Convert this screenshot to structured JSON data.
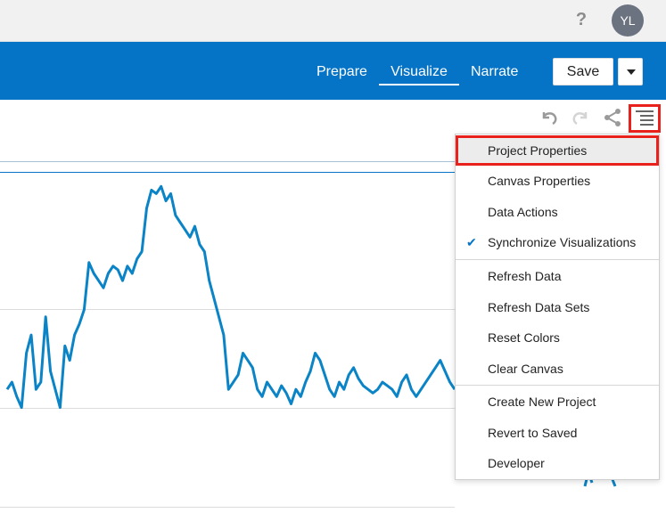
{
  "header": {
    "help_glyph": "?",
    "avatar_initials": "YL"
  },
  "nav": {
    "tabs": [
      {
        "label": "Prepare",
        "active": false
      },
      {
        "label": "Visualize",
        "active": true
      },
      {
        "label": "Narrate",
        "active": false
      }
    ],
    "save_label": "Save"
  },
  "toolbar": {
    "icons": [
      "undo-icon",
      "redo-icon",
      "share-icon",
      "menu-icon"
    ]
  },
  "menu": {
    "group1": [
      {
        "label": "Project Properties",
        "highlighted": true,
        "checked": false
      },
      {
        "label": "Canvas Properties",
        "highlighted": false,
        "checked": false
      },
      {
        "label": "Data Actions",
        "highlighted": false,
        "checked": false
      },
      {
        "label": "Synchronize Visualizations",
        "highlighted": false,
        "checked": true
      }
    ],
    "group2": [
      {
        "label": "Refresh Data"
      },
      {
        "label": "Refresh Data Sets"
      },
      {
        "label": "Reset Colors"
      },
      {
        "label": "Clear Canvas"
      }
    ],
    "group3": [
      {
        "label": "Create New Project"
      },
      {
        "label": "Revert to Saved"
      },
      {
        "label": "Developer"
      }
    ],
    "check_glyph": "✔"
  },
  "colors": {
    "brand": "#0574c6",
    "line": "#0a84c6",
    "highlight_border": "#e8211c"
  },
  "chart_data": {
    "type": "line",
    "series": [
      {
        "values": [
          40,
          42,
          38,
          35,
          50,
          55,
          40,
          42,
          60,
          45,
          40,
          35,
          52,
          48,
          55,
          58,
          62,
          75,
          72,
          70,
          68,
          72,
          74,
          73,
          70,
          74,
          72,
          76,
          78,
          90,
          95,
          94,
          96,
          92,
          94,
          88,
          86,
          84,
          82,
          85,
          80,
          78,
          70,
          65,
          60,
          55,
          40,
          42,
          44,
          50,
          48,
          46,
          40,
          38,
          42,
          40,
          38,
          41,
          39,
          36,
          40,
          38,
          42,
          45,
          50,
          48,
          44,
          40,
          38,
          42,
          40,
          44,
          46,
          43,
          41,
          40,
          39,
          40,
          42,
          41,
          40,
          38,
          42,
          44,
          40,
          38,
          40,
          42,
          44,
          46,
          48,
          45,
          42,
          40
        ]
      }
    ]
  }
}
